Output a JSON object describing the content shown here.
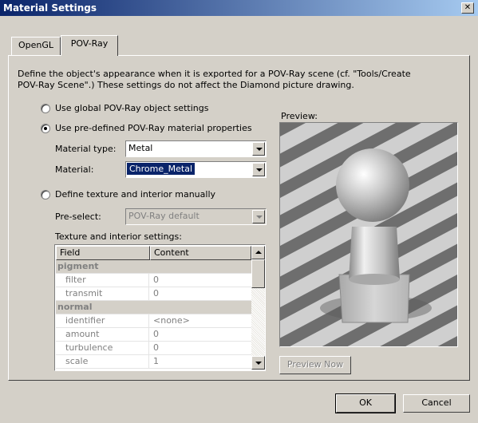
{
  "window": {
    "title": "Material Settings",
    "close_glyph": "✕"
  },
  "tabs": [
    {
      "label": "OpenGL",
      "active": false
    },
    {
      "label": "POV-Ray",
      "active": true
    }
  ],
  "description": [
    "Define the object's appearance when it is exported for a POV-Ray scene (cf. \"Tools/Create",
    "POV-Ray Scene\".) These settings do not affect the Diamond picture drawing."
  ],
  "options": {
    "global_label": "Use global POV-Ray object settings",
    "predefined_label": "Use pre-defined POV-Ray material properties",
    "manual_label": "Define texture and interior manually",
    "selected": "predefined"
  },
  "material_type": {
    "label": "Material type:",
    "value": "Metal"
  },
  "material": {
    "label": "Material:",
    "value": "Chrome_Metal"
  },
  "preselect": {
    "label": "Pre-select:",
    "value": "POV-Ray default"
  },
  "texture": {
    "label": "Texture and interior settings:",
    "columns": [
      "Field",
      "Content"
    ],
    "rows": [
      {
        "group": "pigment"
      },
      {
        "field": "filter",
        "content": "0"
      },
      {
        "field": "transmit",
        "content": "0"
      },
      {
        "group": "normal"
      },
      {
        "field": "identifier",
        "content": "<none>"
      },
      {
        "field": "amount",
        "content": "0"
      },
      {
        "field": "turbulence",
        "content": "0"
      },
      {
        "field": "scale",
        "content": "1"
      }
    ]
  },
  "preview": {
    "label": "Preview:",
    "button": "Preview Now"
  },
  "footer": {
    "ok": "OK",
    "cancel": "Cancel"
  },
  "colors": {
    "title_bar": "#0a246a",
    "selection": "#0a246a",
    "dialog": "#d4d0c8"
  },
  "icons": [
    "close-icon",
    "radio-icon",
    "dropdown-arrow-icon",
    "scroll-up-icon",
    "scroll-down-icon"
  ]
}
